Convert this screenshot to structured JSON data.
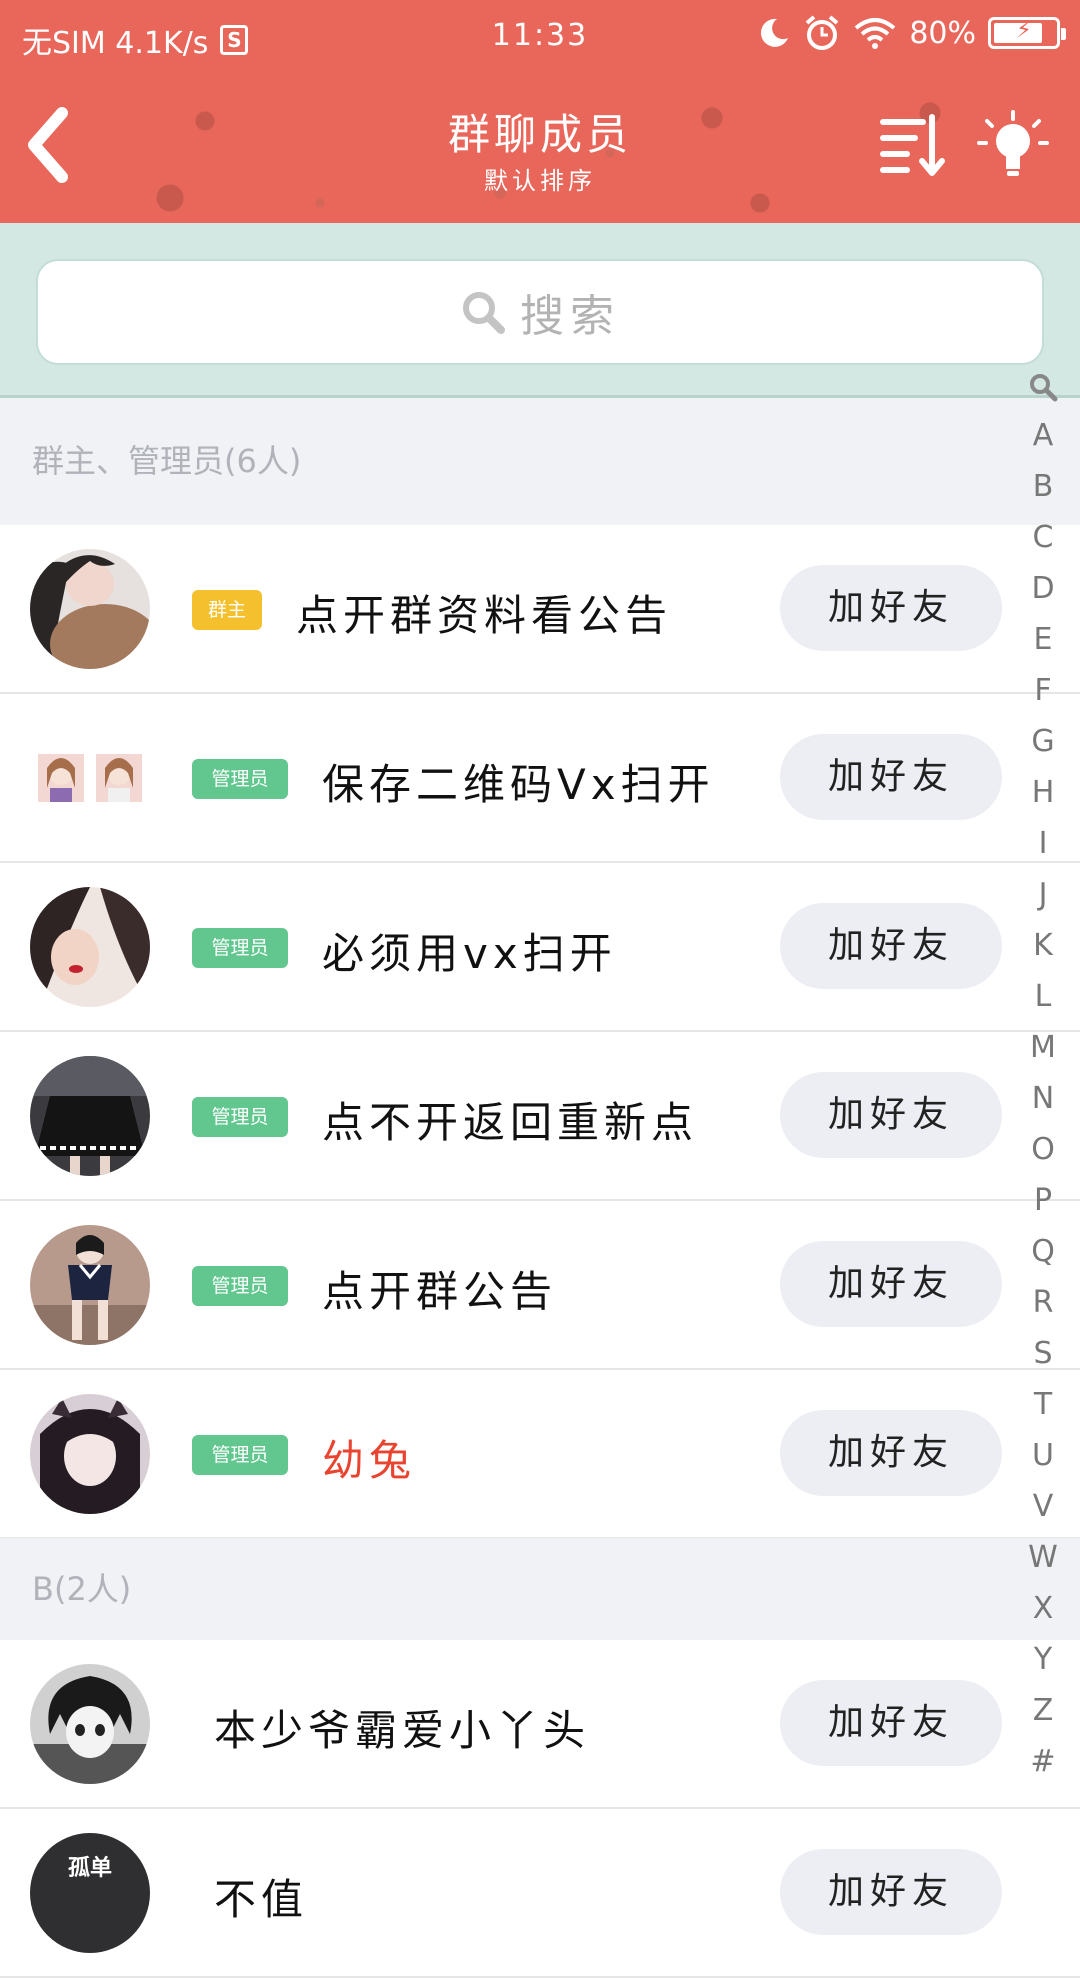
{
  "status_bar": {
    "carrier": "无SIM 4.1K/s",
    "app_icon": "S",
    "time": "11:33",
    "battery": "80%",
    "battery_level": 0.8,
    "icons": [
      "moon-icon",
      "alarm-icon",
      "wifi-icon",
      "battery-icon"
    ]
  },
  "header": {
    "title": "群聊成员",
    "subtitle": "默认排序",
    "icons": [
      "back-icon",
      "sort-icon",
      "lightbulb-icon"
    ],
    "colors": {
      "primary": "#e8675a",
      "search_bg": "#d3e7e3"
    }
  },
  "search": {
    "placeholder": "搜索"
  },
  "sections": [
    {
      "title": "群主、管理员(6人)",
      "members": [
        {
          "badge": "群主",
          "name": "点开群资料看公告",
          "button": "加好友"
        },
        {
          "badge": "管理员",
          "name": "保存二维码Vx扫开",
          "button": "加好友"
        },
        {
          "badge": "管理员",
          "name": "必须用vx扫开",
          "button": "加好友"
        },
        {
          "badge": "管理员",
          "name": "点不开返回重新点",
          "button": "加好友"
        },
        {
          "badge": "管理员",
          "name": "点开群公告",
          "button": "加好友"
        },
        {
          "badge": "管理员",
          "name": "幼兔",
          "button": "加好友",
          "name_color": "#e8442f"
        }
      ]
    },
    {
      "title": "B(2人)",
      "members": [
        {
          "name": "本少爷霸爱小丫头",
          "button": "加好友"
        },
        {
          "name": "不值",
          "button": "加好友",
          "avatar_text": "孤单"
        }
      ]
    }
  ],
  "index_bar": [
    "A",
    "B",
    "C",
    "D",
    "E",
    "F",
    "G",
    "H",
    "I",
    "J",
    "K",
    "L",
    "M",
    "N",
    "O",
    "P",
    "Q",
    "R",
    "S",
    "T",
    "U",
    "V",
    "W",
    "X",
    "Y",
    "Z",
    "#"
  ]
}
